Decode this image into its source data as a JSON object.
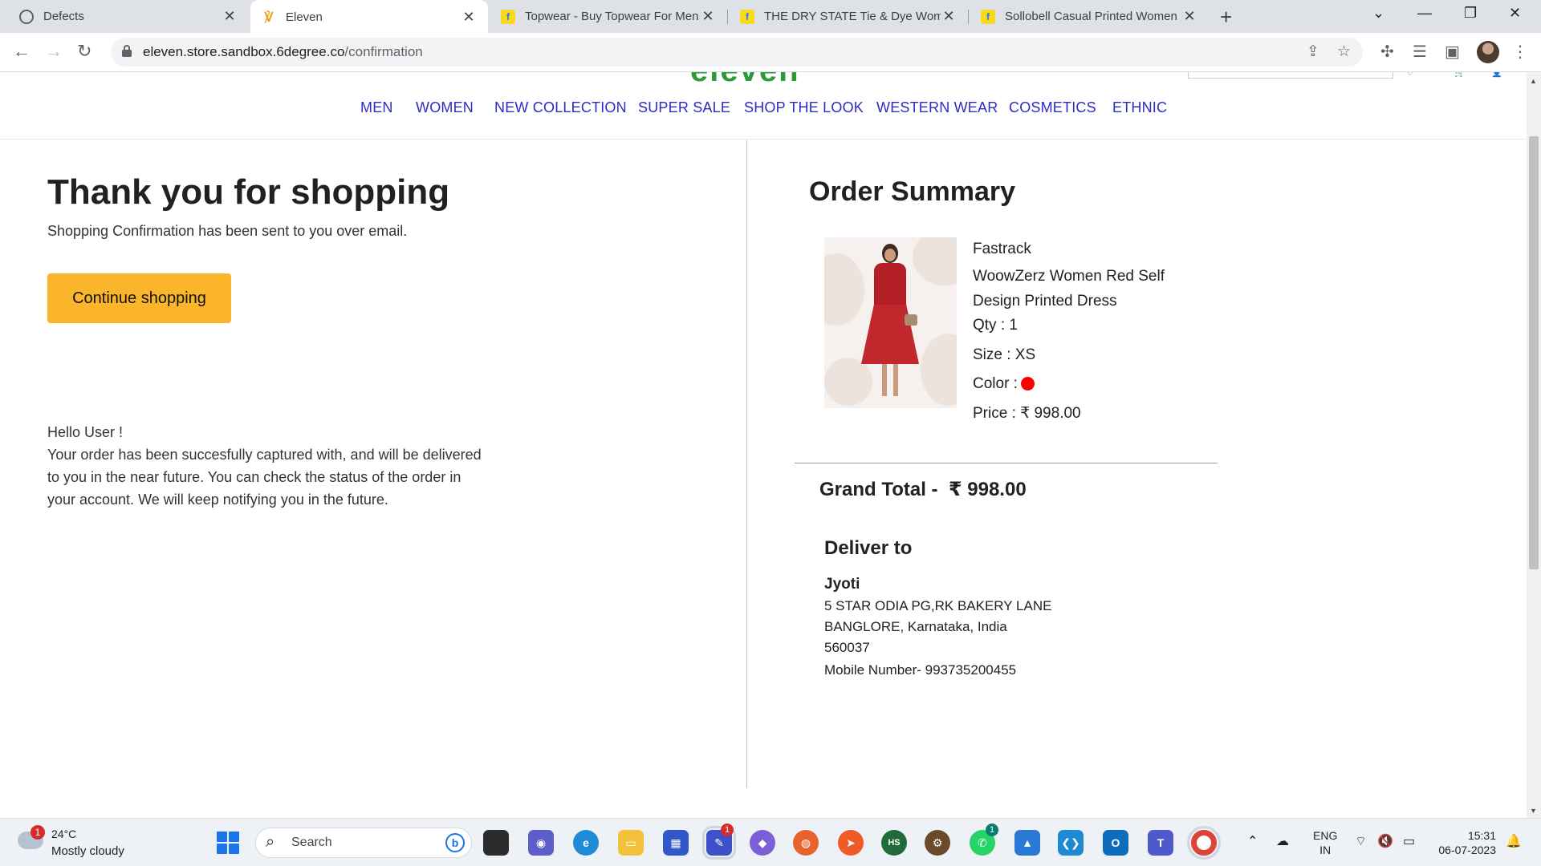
{
  "browser": {
    "tabs": [
      {
        "title": "Defects",
        "favicon": "globe-icon"
      },
      {
        "title": "Eleven",
        "favicon": "eleven-logo-icon",
        "active": true
      },
      {
        "title": "Topwear - Buy Topwear For Men,",
        "favicon": "flipkart-icon"
      },
      {
        "title": "THE DRY STATE Tie & Dye Wome",
        "favicon": "flipkart-icon"
      },
      {
        "title": "Sollobell Casual Printed Women",
        "favicon": "flipkart-icon"
      }
    ],
    "url_host": "eleven.store.sandbox.6degree.co",
    "url_path": "/confirmation"
  },
  "site": {
    "logo_text": "eleven",
    "header_icons": [
      "wishlist",
      "cart",
      "profile"
    ],
    "nav": [
      "MEN",
      "WOMEN",
      "NEW COLLECTION",
      "SUPER SALE",
      "SHOP THE LOOK",
      "WESTERN WEAR",
      "COSMETICS",
      "ETHNIC"
    ]
  },
  "confirmation": {
    "title": "Thank you for shopping",
    "subtitle": "Shopping Confirmation has been sent to you over email.",
    "continue_label": "Continue shopping",
    "greeting": "Hello User !",
    "message_lines": [
      "Your order has been succesfully captured with, and will be delivered",
      "to you in the near future. You can check the status of the order in",
      "your account. We will keep notifying you in the future."
    ]
  },
  "order_summary": {
    "title": "Order Summary",
    "item": {
      "brand": "Fastrack",
      "name_line1": "WoowZerz Women Red Self",
      "name_line2": "Design Printed Dress",
      "qty": "Qty : 1",
      "size": "Size : XS",
      "color_label": "Color :",
      "color_value": "#ff0000",
      "price": "Price : ₹ 998.00"
    },
    "grand_total": "Grand Total -  ₹ 998.00"
  },
  "delivery": {
    "title": "Deliver to",
    "name": "Jyoti",
    "line1": "5 STAR ODIA PG,RK BAKERY LANE",
    "line2": "BANGLORE,  Karnataka,  India",
    "pincode": "560037",
    "mobile": "Mobile Number- 993735200455"
  },
  "taskbar": {
    "weather_badge": "1",
    "temperature": "24°C",
    "weather": "Mostly cloudy",
    "search_label": "Search",
    "language_line1": "ENG",
    "language_line2": "IN",
    "time": "15:31",
    "date": "06-07-2023",
    "badges": {
      "app_badge": "1",
      "whatsapp_badge": "1"
    }
  },
  "colors": {
    "nav_link": "#2c2cc4",
    "cta": "#fbb52b",
    "logo": "#2b9a3a"
  }
}
